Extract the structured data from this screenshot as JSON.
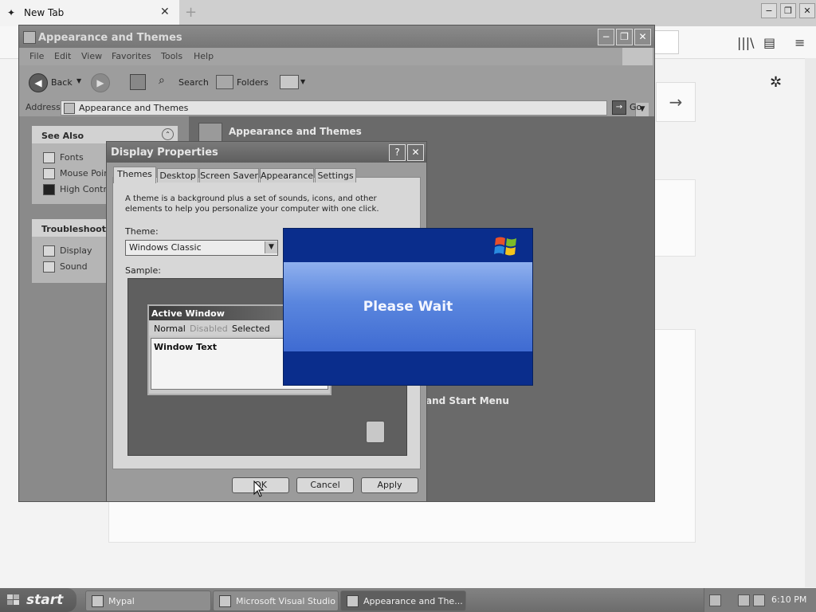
{
  "browser": {
    "tab_title": "New Tab",
    "tab_close": "✕",
    "new_tab": "+",
    "win_min": "−",
    "win_max": "❐",
    "win_close": "✕",
    "forward_arrow": "→",
    "gear": "✲",
    "library": "|||\\",
    "sidebar": "▤",
    "menu": "≡"
  },
  "explorer": {
    "title": "Appearance and Themes",
    "menu": [
      "File",
      "Edit",
      "View",
      "Favorites",
      "Tools",
      "Help"
    ],
    "toolbar": {
      "back": "Back",
      "search": "Search",
      "folders": "Folders"
    },
    "address": {
      "label": "Address",
      "value": "Appearance and Themes",
      "go": "Go"
    },
    "see_also": {
      "title": "See Also",
      "items": [
        "Fonts",
        "Mouse Point",
        "High Contra"
      ]
    },
    "troubleshooters": {
      "title": "Troubleshoote",
      "items": [
        "Display",
        "Sound"
      ]
    },
    "main_heading": "Appearance and Themes",
    "task_fragment": "and Start Menu"
  },
  "dialog": {
    "title": "Display Properties",
    "help": "?",
    "close": "✕",
    "tabs": [
      "Themes",
      "Desktop",
      "Screen Saver",
      "Appearance",
      "Settings"
    ],
    "description": "A theme is a background plus a set of sounds, icons, and other elements to help you personalize your computer with one click.",
    "theme_label": "Theme:",
    "theme_value": "Windows Classic",
    "sample_label": "Sample:",
    "sample": {
      "window_title": "Active Window",
      "menu": [
        "Normal",
        "Disabled",
        "Selected"
      ],
      "window_text": "Window Text"
    },
    "buttons": {
      "ok": "OK",
      "cancel": "Cancel",
      "apply": "Apply"
    }
  },
  "wait_dialog": {
    "message": "Please Wait"
  },
  "taskbar": {
    "start": "start",
    "tasks": [
      "Mypal",
      "Microsoft Visual Studio",
      "Appearance and The..."
    ],
    "clock": "6:10 PM"
  }
}
